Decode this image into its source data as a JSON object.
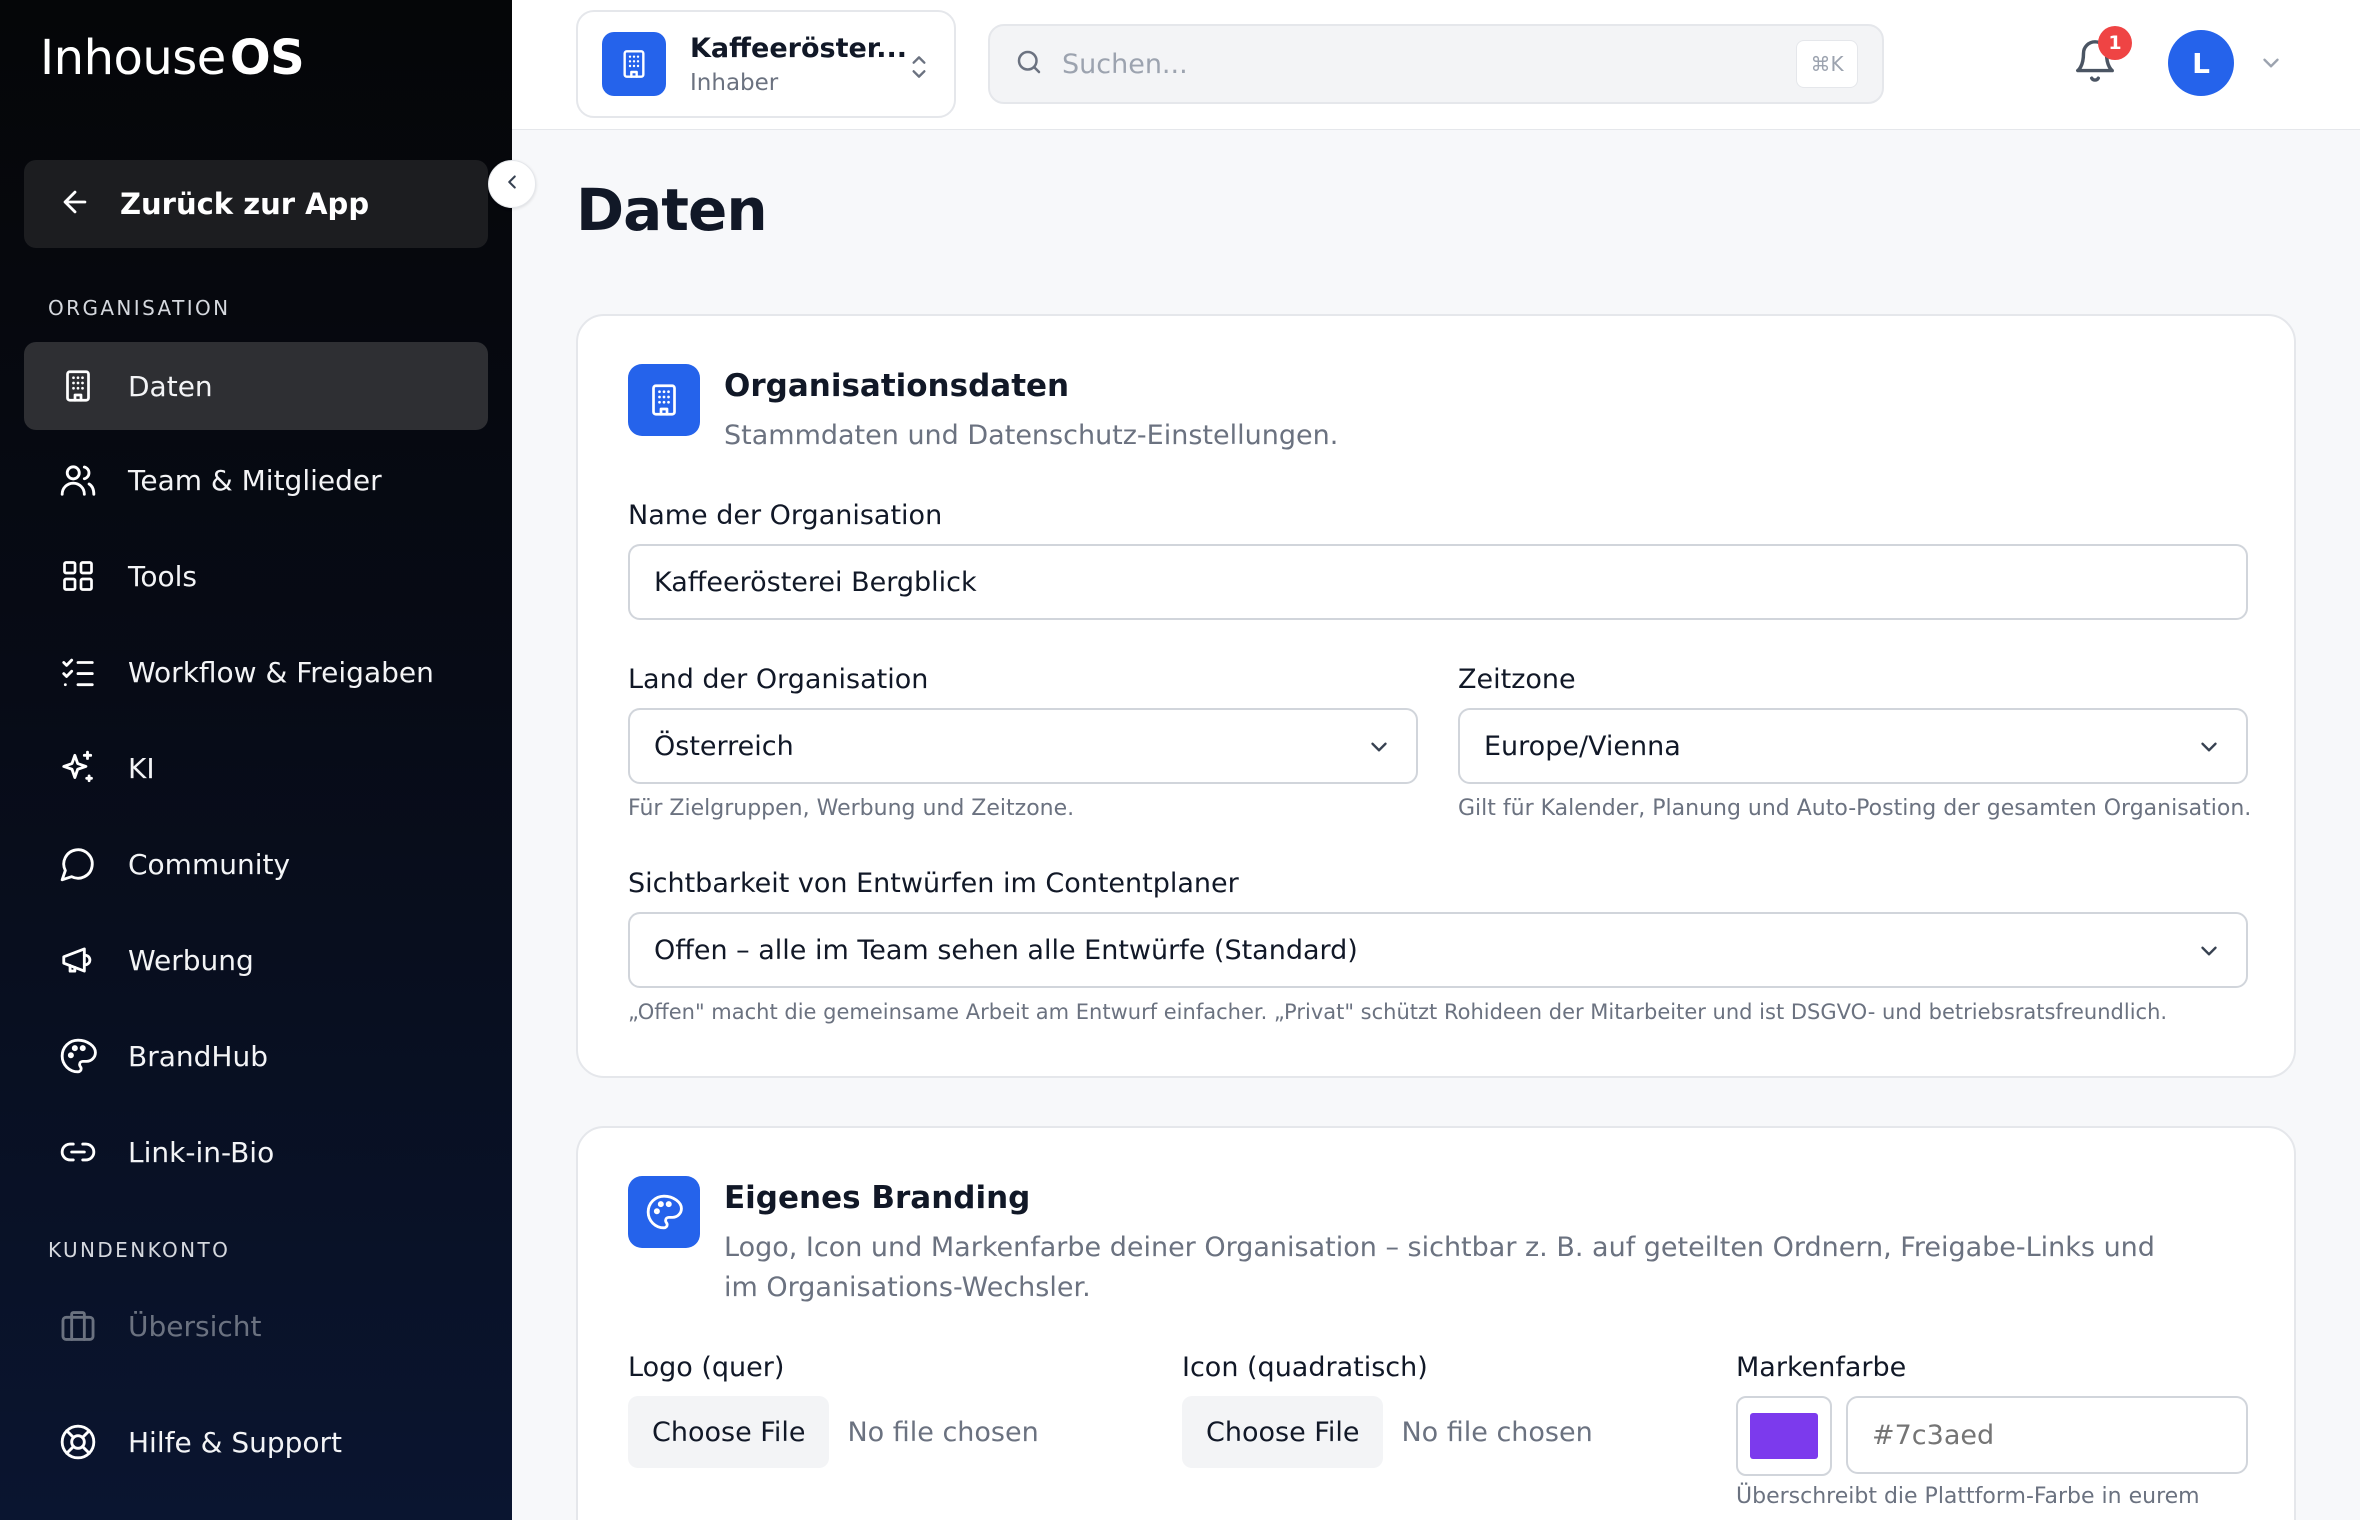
{
  "app": {
    "logo_thin": "Inhouse",
    "logo_bold": "OS"
  },
  "sidebar": {
    "back_label": "Zurück zur App",
    "section_org": "ORGANISATION",
    "section_account": "KUNDENKONTO",
    "items": [
      {
        "label": "Daten",
        "icon": "building-icon"
      },
      {
        "label": "Team & Mitglieder",
        "icon": "users-icon"
      },
      {
        "label": "Tools",
        "icon": "grid-icon"
      },
      {
        "label": "Workflow & Freigaben",
        "icon": "checklist-icon"
      },
      {
        "label": "KI",
        "icon": "sparkles-icon"
      },
      {
        "label": "Community",
        "icon": "chat-icon"
      },
      {
        "label": "Werbung",
        "icon": "megaphone-icon"
      },
      {
        "label": "BrandHub",
        "icon": "palette-icon"
      },
      {
        "label": "Link-in-Bio",
        "icon": "link-icon"
      }
    ],
    "account_items": [
      {
        "label": "Übersicht",
        "icon": "briefcase-icon"
      }
    ],
    "help_label": "Hilfe & Support"
  },
  "topbar": {
    "org_name": "Kaffeeröster...",
    "org_role": "Inhaber",
    "search_placeholder": "Suchen...",
    "search_shortcut": "⌘K",
    "notification_count": "1",
    "avatar_initial": "L"
  },
  "page": {
    "title": "Daten"
  },
  "org_card": {
    "title": "Organisationsdaten",
    "subtitle": "Stammdaten und Datenschutz-Einstellungen.",
    "name_label": "Name der Organisation",
    "name_value": "Kaffeerösterei Bergblick",
    "country_label": "Land der Organisation",
    "country_value": "Österreich",
    "country_help": "Für Zielgruppen, Werbung und Zeitzone.",
    "timezone_label": "Zeitzone",
    "timezone_value": "Europe/Vienna",
    "timezone_help": "Gilt für Kalender, Planung und Auto-Posting der gesamten Organisation.",
    "visibility_label": "Sichtbarkeit von Entwürfen im Contentplaner",
    "visibility_value": "Offen – alle im Team sehen alle Entwürfe (Standard)",
    "visibility_help": "„Offen\" macht die gemeinsame Arbeit am Entwurf einfacher. „Privat\" schützt Rohideen der Mitarbeiter und ist DSGVO- und betriebsratsfreundlich."
  },
  "branding_card": {
    "title": "Eigenes Branding",
    "subtitle": "Logo, Icon und Markenfarbe deiner Organisation – sichtbar z. B. auf geteilten Ordnern, Freigabe-Links und im Organisations-Wechsler.",
    "logo_label": "Logo (quer)",
    "icon_label": "Icon (quadratisch)",
    "color_label": "Markenfarbe",
    "choose_file": "Choose File",
    "no_file": "No file chosen",
    "color_placeholder": "#7c3aed",
    "color_swatch": "#7c3aed",
    "color_help": "Überschreibt die Plattform-Farbe in eurem"
  },
  "colors": {
    "accent": "#2563eb",
    "badge": "#ef4444"
  }
}
